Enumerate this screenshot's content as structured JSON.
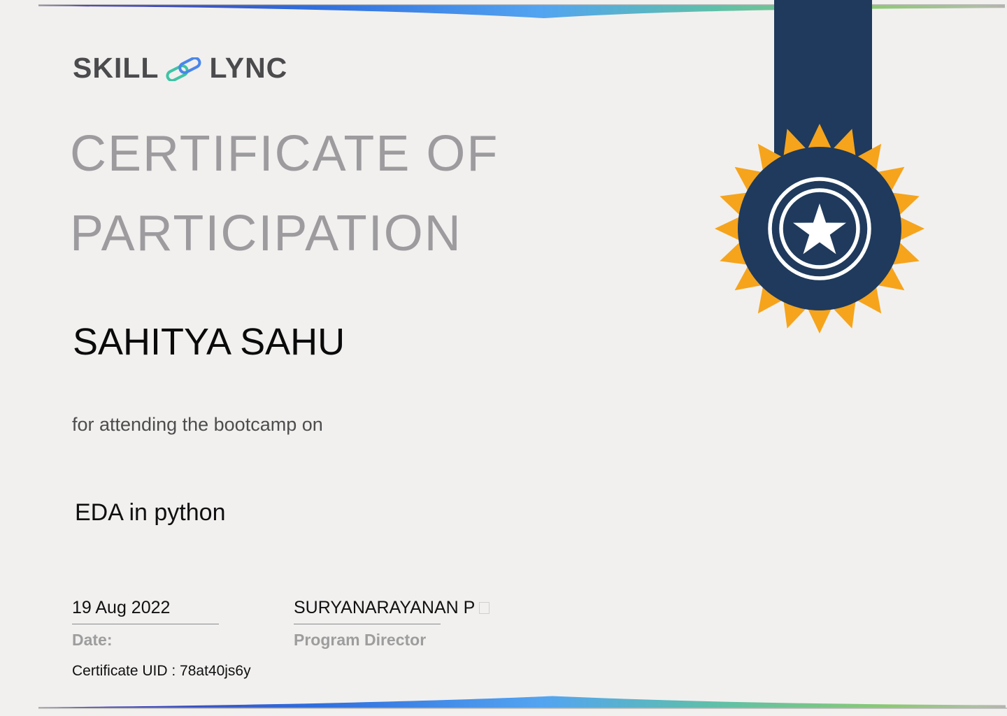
{
  "brand": {
    "word_left": "SKILL",
    "word_right": "LYNC",
    "link_icon": "chain-link-icon"
  },
  "title": {
    "line1": "CERTIFICATE OF",
    "line2": "PARTICIPATION"
  },
  "recipient_name": "SAHITYA SAHU",
  "subtitle": "for attending the bootcamp on",
  "course_name": "EDA in python",
  "signature": {
    "date_value": "19 Aug 2022",
    "date_label": "Date:",
    "director_name": "SURYANARAYANAN P",
    "director_label": "Program Director"
  },
  "certificate_uid": "Certificate UID : 78at40js6y",
  "colors": {
    "background": "#f1f0ef",
    "ribbon_navy": "#1f3a5c",
    "medal_orange": "#f6a41c",
    "title_gray": "#9d9b9e",
    "logo_gray": "#4b4b4d",
    "link_teal": "#3ec4a4",
    "link_blue": "#4a86ea",
    "gradient_indigo": "#453aa8",
    "gradient_blue": "#2f6ddd",
    "gradient_lightblue": "#53a4f1",
    "gradient_teal": "#5fc0a8",
    "gradient_green": "#8cc973"
  }
}
